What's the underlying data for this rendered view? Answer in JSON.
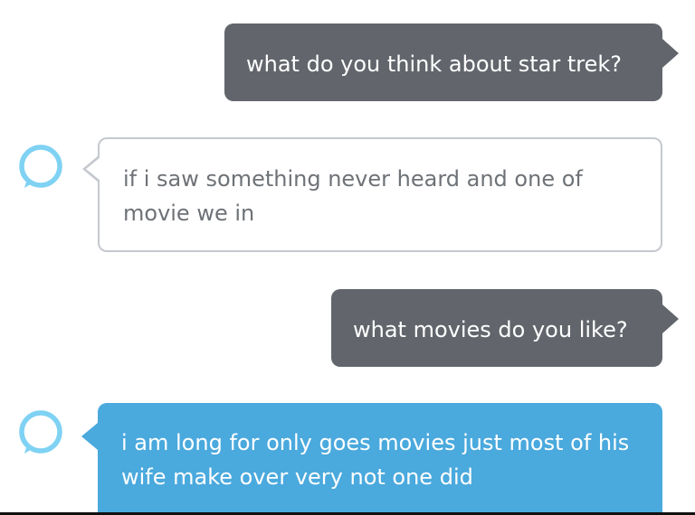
{
  "conversation": {
    "messages": [
      {
        "speaker": "user",
        "text": "what do you think about star trek?"
      },
      {
        "speaker": "alexa",
        "text": "if i saw something never heard and one of movie we in"
      },
      {
        "speaker": "user",
        "text": "what movies do you like?"
      },
      {
        "speaker": "alexa",
        "text": "i am long for only goes movies just most of his wife make over very not one did"
      }
    ]
  },
  "icons": {
    "alexa_avatar": "alexa-ring-icon"
  },
  "colors": {
    "user_bubble": "#62666c",
    "alexa_bubble_outline": "#c5c9ce",
    "alexa_bubble_active": "#4aa9dd",
    "alexa_ring": "#7fd2f3"
  }
}
